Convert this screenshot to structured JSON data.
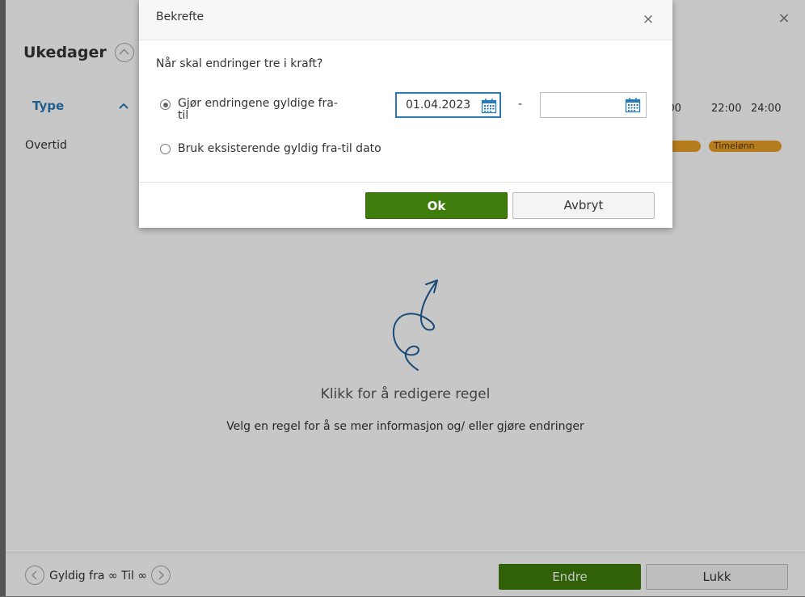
{
  "panel": {
    "title": "Ukedager",
    "close_glyph": "×",
    "type_header": "Type",
    "time_labels": [
      ":00",
      "22:00",
      "24:00"
    ],
    "rows": [
      {
        "label": "Overtid"
      }
    ],
    "bar_label": "Timelønn",
    "empty_title": "Klikk for å redigere regel",
    "empty_subtitle": "Velg en regel for å se mer informasjon og/ eller gjøre endringer",
    "footer": {
      "valid_text": "Gyldig fra ∞ Til ∞",
      "edit_label": "Endre",
      "close_label": "Lukk"
    }
  },
  "dialog": {
    "title": "Bekrefte",
    "close_glyph": "×",
    "question": "Når skal endringer tre i kraft?",
    "option1_label": "Gjør endringene gyldige fra-til",
    "option1_checked": true,
    "option2_label": "Bruk eksisterende gyldig fra-til dato",
    "option2_checked": false,
    "date_from": "01.04.2023",
    "date_to": "",
    "separator": "-",
    "ok_label": "Ok",
    "cancel_label": "Avbryt"
  },
  "colors": {
    "primary_green": "#3e7d0c",
    "link_blue": "#2a7ab5",
    "bar_orange": "#e8a027",
    "squiggle_blue": "#1f5f99"
  },
  "icons": {
    "close": "close-icon",
    "calendar": "calendar-icon",
    "chevron_up": "chevron-up-icon",
    "chevron_left": "chevron-left-icon",
    "chevron_right": "chevron-right-icon",
    "arrow": "squiggle-arrow-icon"
  }
}
